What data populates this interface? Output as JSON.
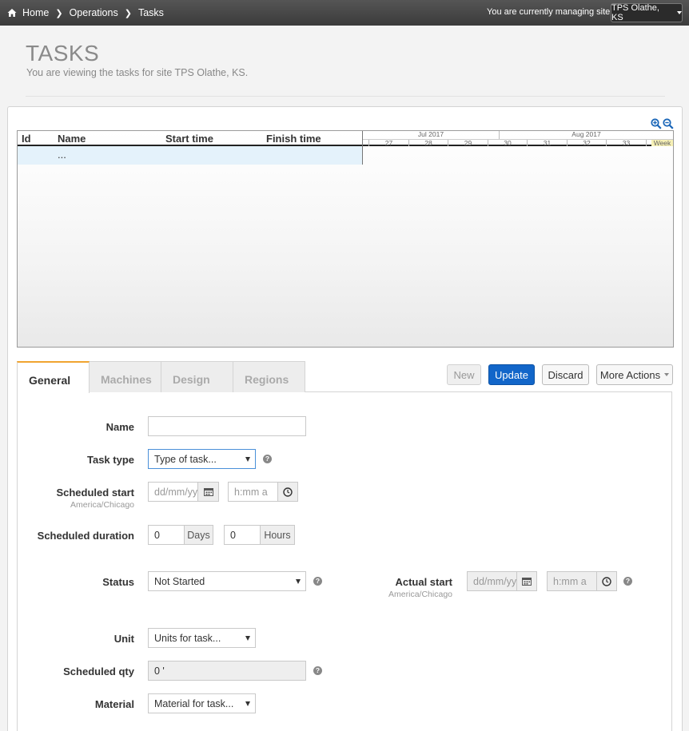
{
  "breadcrumb": {
    "home": "Home",
    "operations": "Operations",
    "tasks": "Tasks"
  },
  "site": {
    "managing_label": "You are currently managing site:",
    "current": "TPS Olathe, KS"
  },
  "page": {
    "title": "TASKS",
    "subtitle": "You are viewing the tasks for site TPS Olathe, KS."
  },
  "gantt": {
    "columns": [
      "Id",
      "Name",
      "Start time",
      "Finish time"
    ],
    "rows": [
      {
        "name": "..."
      }
    ],
    "months": [
      "Jul 2017",
      "Aug 2017"
    ],
    "weeks": [
      "27",
      "28",
      "29",
      "30",
      "31",
      "32",
      "33",
      "Week"
    ]
  },
  "tabs": [
    "General",
    "Machines",
    "Design",
    "Regions"
  ],
  "actions": {
    "new": "New",
    "update": "Update",
    "discard": "Discard",
    "more": "More Actions"
  },
  "form": {
    "name_label": "Name",
    "name_value": "",
    "task_type_label": "Task type",
    "task_type_value": "Type of task...",
    "scheduled_start_label": "Scheduled start",
    "timezone": "America/Chicago",
    "date_placeholder": "dd/mm/yy",
    "time_placeholder": "h:mm a",
    "scheduled_duration_label": "Scheduled duration",
    "days_value": "0",
    "days_label": "Days",
    "hours_value": "0",
    "hours_label": "Hours",
    "status_label": "Status",
    "status_value": "Not Started",
    "actual_start_label": "Actual start",
    "unit_label": "Unit",
    "unit_value": "Units for task...",
    "scheduled_qty_label": "Scheduled qty",
    "scheduled_qty_value": "0 '",
    "material_label": "Material",
    "material_value": "Material for task..."
  },
  "colors": {
    "accent": "#1266c9",
    "active_tab": "#f0a430",
    "topbar": "#3b3b3b"
  }
}
